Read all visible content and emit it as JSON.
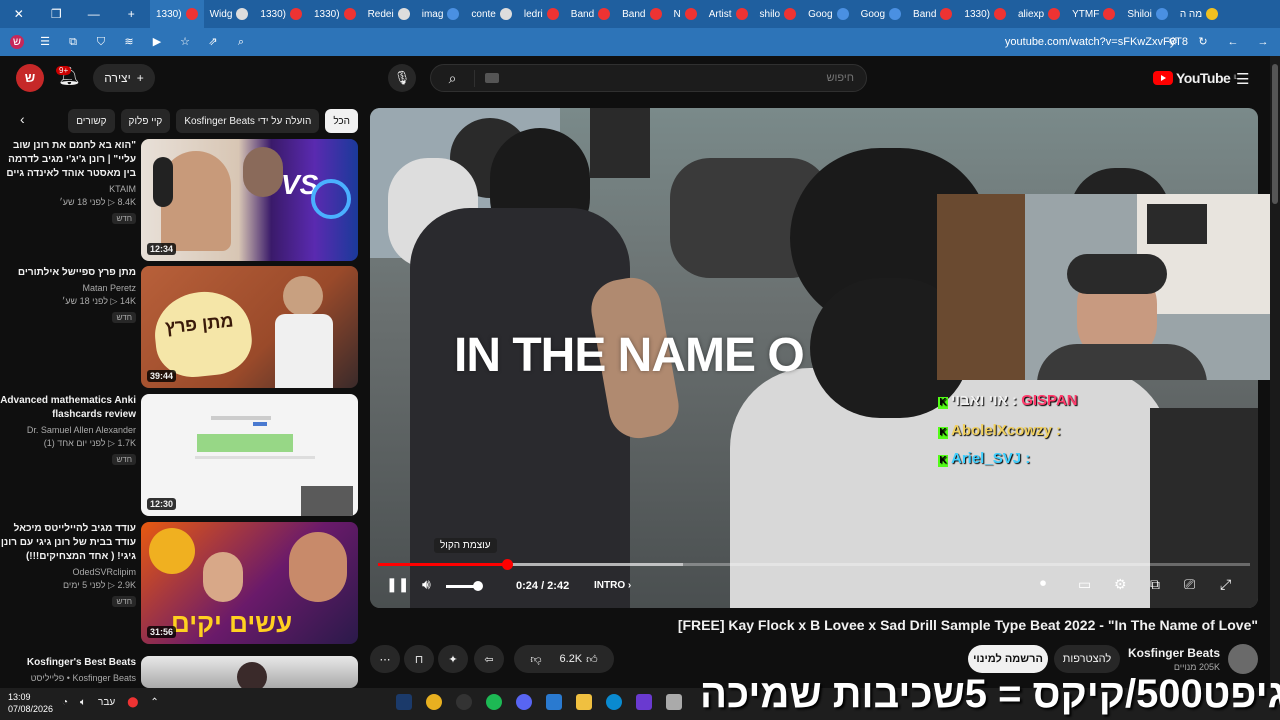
{
  "browser": {
    "tabs": [
      {
        "label": "מה ה"
      },
      {
        "label": "Shiloi"
      },
      {
        "label": "YTMF"
      },
      {
        "label": "aliexp"
      },
      {
        "label": "(1330"
      },
      {
        "label": "Band"
      },
      {
        "label": "Goog"
      },
      {
        "label": "Goog"
      },
      {
        "label": "shilo"
      },
      {
        "label": "Artist"
      },
      {
        "label": "N"
      },
      {
        "label": "Band"
      },
      {
        "label": "Band"
      },
      {
        "label": "ledri"
      },
      {
        "label": "conte"
      },
      {
        "label": "imag"
      },
      {
        "label": "Redei"
      },
      {
        "label": "(1330"
      },
      {
        "label": "(1330"
      },
      {
        "label": "Widg"
      },
      {
        "label": "(1330"
      }
    ],
    "url": "youtube.com/watch?v=sFKwZxvFyT8"
  },
  "header": {
    "avatar_letter": "ש",
    "notif_badge": "9+",
    "create_label": "יצירה",
    "search_placeholder": "חיפוש",
    "logo": "YouTube",
    "logo_region": "IL"
  },
  "chips": [
    "הכל",
    "הועלה על ידי Kosfinger Beats",
    "קיי פלוק",
    "קשורים"
  ],
  "recommended": [
    {
      "title": "\"הוא בא לחמם את רונן שוב עליי\" | רונן ג'יג'י מגיב לדרמה בין מאסטר אוהד לאינדה גיים",
      "channel": "KTAIM",
      "views": "8.4K",
      "age": "לפני 18 שע׳",
      "badge": "חדש",
      "duration": "12:34"
    },
    {
      "title": "מתן פרץ ספיישל אילתורים",
      "channel": "Matan Peretz",
      "views": "14K",
      "age": "לפני 18 שע׳",
      "badge": "חדש",
      "duration": "39:44"
    },
    {
      "title": "Advanced mathematics Anki flashcards review",
      "channel": "Dr. Samuel Allen Alexander",
      "views": "1.7K",
      "age": "לפני יום אחד (1)",
      "badge": "חדש",
      "duration": "12:30"
    },
    {
      "title": "עודד מגיב להיילייטס מיכאל עודד בבית של רונן גיגי עם רונן גיגי! ( אחד המצחיקים!!!)",
      "channel": "OdedSVRclipim",
      "views": "2.9K",
      "age": "לפני 5 ימים",
      "badge": "חדש",
      "duration": "31:56"
    },
    {
      "title": "Kosfinger's Best Beats",
      "channel": "Kosfinger Beats • פלייליסט",
      "views": "",
      "age": "",
      "badge": "",
      "duration": ""
    }
  ],
  "player": {
    "overlay_text": "IN THE NAME O",
    "tooltip": "עוצמת הקול",
    "time": "0:24 / 2:42",
    "chapter": "INTRO",
    "progress_fraction": 0.148,
    "buffer_fraction": 0.35,
    "volume_fraction": 0.8
  },
  "chat": [
    {
      "name": "GISPAN",
      "prefix": "אוי ואבוי : ",
      "color": "#ff3b6b"
    },
    {
      "name": "AbolelXcowzy :",
      "prefix": "",
      "color": "#f0d060"
    },
    {
      "name": "Ariel_SVJ :",
      "prefix": "",
      "color": "#40d0ff"
    }
  ],
  "video": {
    "title": "[FREE] Kay Flock x B Lovee x Sad Drill Sample Type Beat 2022 - \"In The Name of Love\"",
    "channel": "Kosfinger Beats",
    "subscribers": "205K מנויים",
    "join_label": "להצטרפות",
    "subscribe_label": "הרשמה למינוי",
    "likes": "6.2K"
  },
  "stream_overlay": "גיפט500/קיקס = 5שכיבות שמיכה",
  "taskbar": {
    "time": "13:09",
    "date": "07/08/2026",
    "lang": "עבר"
  }
}
